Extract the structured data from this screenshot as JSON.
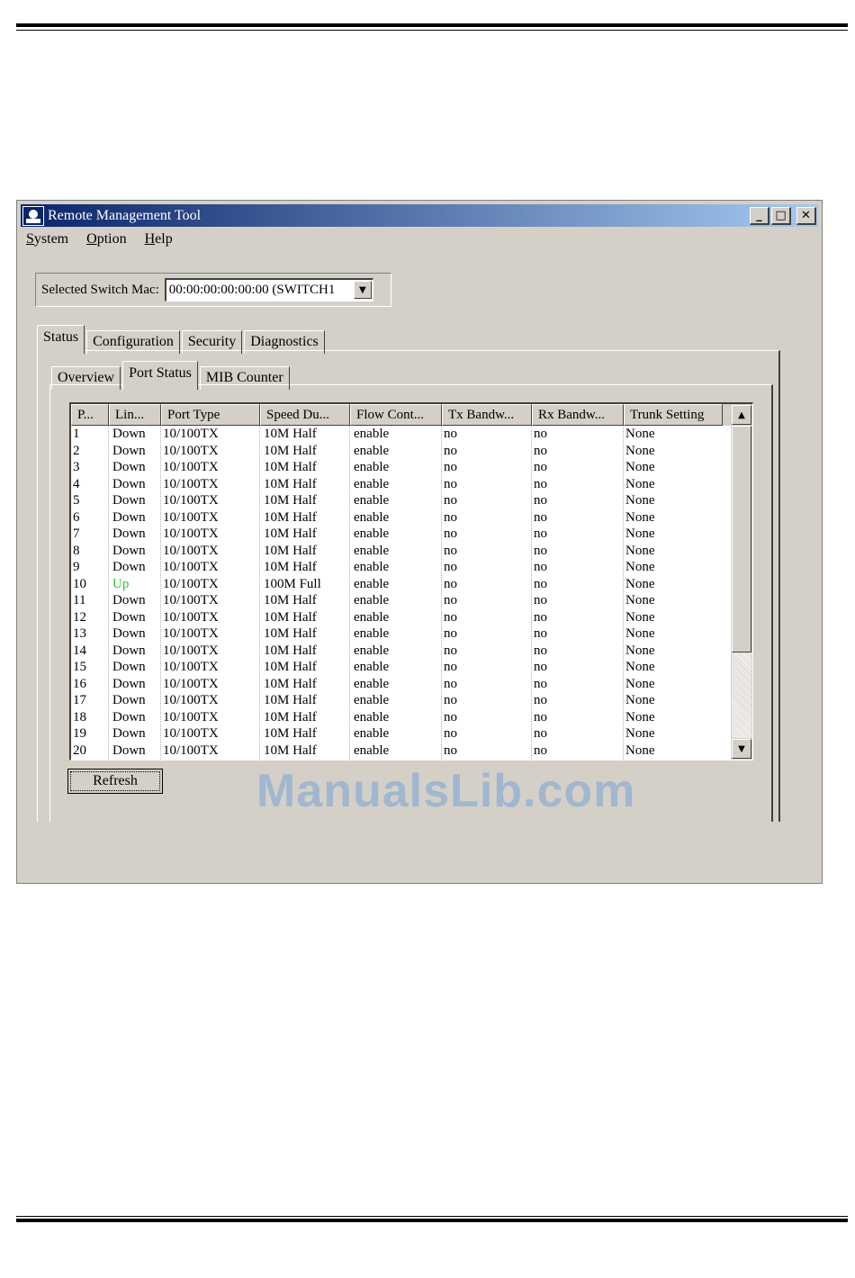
{
  "window": {
    "title": "Remote Management Tool",
    "buttons": {
      "minimize": "_",
      "maximize": "□",
      "close": "✕"
    }
  },
  "menubar": {
    "items": [
      {
        "label": "System",
        "accel": "S",
        "rest": "ystem"
      },
      {
        "label": "Option",
        "accel": "O",
        "rest": "ption"
      },
      {
        "label": "Help",
        "accel": "H",
        "rest": "elp"
      }
    ]
  },
  "switch_select": {
    "label": "Selected Switch Mac:",
    "value": "00:00:00:00:00:00 (SWITCH1"
  },
  "tabs": [
    {
      "label": "Status",
      "active": true
    },
    {
      "label": "Configuration",
      "active": false
    },
    {
      "label": "Security",
      "active": false
    },
    {
      "label": "Diagnostics",
      "active": false
    }
  ],
  "subtabs": [
    {
      "label": "Overview",
      "active": false
    },
    {
      "label": "Port Status",
      "active": true
    },
    {
      "label": "MIB Counter",
      "active": false
    }
  ],
  "table": {
    "columns": [
      "P...",
      "Lin...",
      "Port Type",
      "Speed Du...",
      "Flow Cont...",
      "Tx Bandw...",
      "Rx Bandw...",
      "Trunk Setting"
    ],
    "rows": [
      [
        "1",
        "Down",
        "10/100TX",
        "10M Half",
        "enable",
        "no",
        "no",
        "None"
      ],
      [
        "2",
        "Down",
        "10/100TX",
        "10M Half",
        "enable",
        "no",
        "no",
        "None"
      ],
      [
        "3",
        "Down",
        "10/100TX",
        "10M Half",
        "enable",
        "no",
        "no",
        "None"
      ],
      [
        "4",
        "Down",
        "10/100TX",
        "10M Half",
        "enable",
        "no",
        "no",
        "None"
      ],
      [
        "5",
        "Down",
        "10/100TX",
        "10M Half",
        "enable",
        "no",
        "no",
        "None"
      ],
      [
        "6",
        "Down",
        "10/100TX",
        "10M Half",
        "enable",
        "no",
        "no",
        "None"
      ],
      [
        "7",
        "Down",
        "10/100TX",
        "10M Half",
        "enable",
        "no",
        "no",
        "None"
      ],
      [
        "8",
        "Down",
        "10/100TX",
        "10M Half",
        "enable",
        "no",
        "no",
        "None"
      ],
      [
        "9",
        "Down",
        "10/100TX",
        "10M Half",
        "enable",
        "no",
        "no",
        "None"
      ],
      [
        "10",
        "Up",
        "10/100TX",
        "100M Full",
        "enable",
        "no",
        "no",
        "None"
      ],
      [
        "11",
        "Down",
        "10/100TX",
        "10M Half",
        "enable",
        "no",
        "no",
        "None"
      ],
      [
        "12",
        "Down",
        "10/100TX",
        "10M Half",
        "enable",
        "no",
        "no",
        "None"
      ],
      [
        "13",
        "Down",
        "10/100TX",
        "10M Half",
        "enable",
        "no",
        "no",
        "None"
      ],
      [
        "14",
        "Down",
        "10/100TX",
        "10M Half",
        "enable",
        "no",
        "no",
        "None"
      ],
      [
        "15",
        "Down",
        "10/100TX",
        "10M Half",
        "enable",
        "no",
        "no",
        "None"
      ],
      [
        "16",
        "Down",
        "10/100TX",
        "10M Half",
        "enable",
        "no",
        "no",
        "None"
      ],
      [
        "17",
        "Down",
        "10/100TX",
        "10M Half",
        "enable",
        "no",
        "no",
        "None"
      ],
      [
        "18",
        "Down",
        "10/100TX",
        "10M Half",
        "enable",
        "no",
        "no",
        "None"
      ],
      [
        "19",
        "Down",
        "10/100TX",
        "10M Half",
        "enable",
        "no",
        "no",
        "None"
      ],
      [
        "20",
        "Down",
        "10/100TX",
        "10M Half",
        "enable",
        "no",
        "no",
        "None"
      ]
    ],
    "status_up_color": "#2ec02e"
  },
  "scrollbar": {
    "up_arrow": "▲",
    "down_arrow": "▼"
  },
  "refresh_button": {
    "label": "Refresh"
  },
  "watermark": {
    "text": "ManualsLib.com"
  },
  "colors": {
    "titlebar_start": "#0a246a",
    "titlebar_end": "#a6caf0",
    "window_face": "#d4d0c8"
  }
}
